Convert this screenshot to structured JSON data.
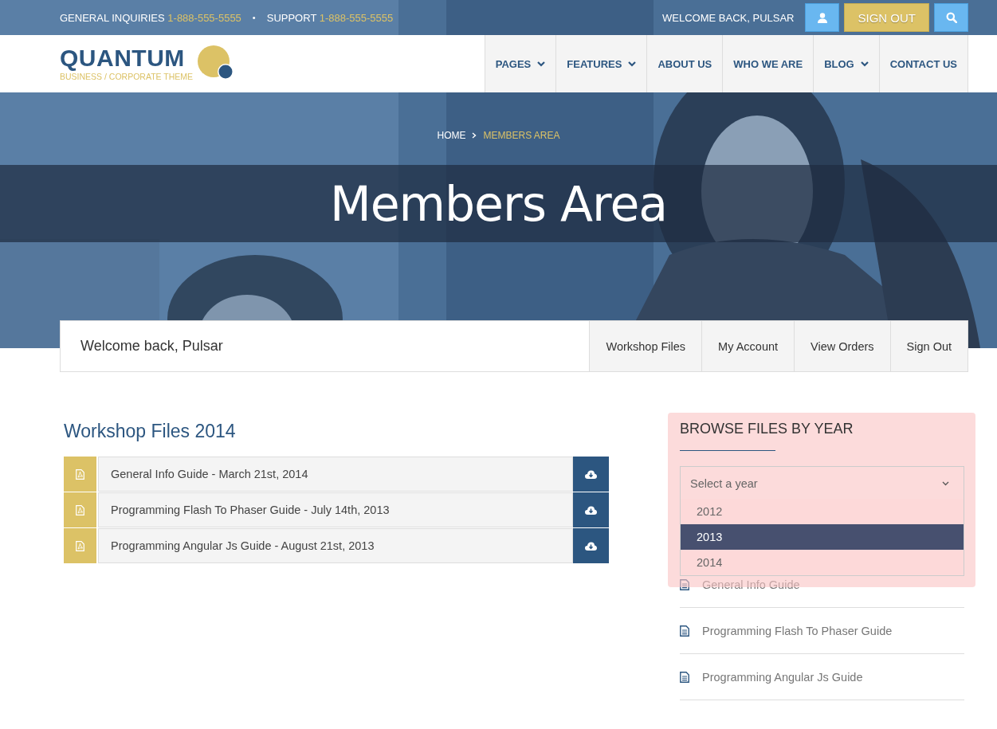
{
  "top_bar": {
    "inquiries_label": "GENERAL INQUIRIES",
    "inquiries_phone": "1-888-555-5555",
    "separator": "•",
    "support_label": "SUPPORT",
    "support_phone": "1-888-555-5555",
    "welcome": "WELCOME BACK, PULSAR",
    "sign_out": "SIGN OUT"
  },
  "logo": {
    "name": "QUANTUM",
    "tagline": "BUSINESS / CORPORATE THEME"
  },
  "nav": [
    {
      "label": "PAGES",
      "has_menu": true
    },
    {
      "label": "FEATURES",
      "has_menu": true
    },
    {
      "label": "ABOUT US",
      "has_menu": false
    },
    {
      "label": "WHO WE ARE",
      "has_menu": false
    },
    {
      "label": "BLOG",
      "has_menu": true
    },
    {
      "label": "CONTACT US",
      "has_menu": false
    }
  ],
  "hero": {
    "breadcrumb": [
      {
        "label": "HOME",
        "current": false
      },
      {
        "label": "MEMBERS AREA",
        "current": true
      }
    ],
    "title": "Members Area"
  },
  "member_bar": {
    "welcome": "Welcome back, Pulsar",
    "links": [
      "Workshop Files",
      "My Account",
      "View Orders",
      "Sign Out"
    ]
  },
  "files": {
    "title": "Workshop Files 2014",
    "items": [
      "General Info Guide - March 21st, 2014",
      "Programming Flash To Phaser Guide - July 14th, 2013",
      "Programming Angular Js Guide - August 21st, 2013"
    ]
  },
  "sidebar": {
    "title": "BROWSE FILES BY YEAR",
    "select": {
      "placeholder": "Select a year",
      "options": [
        {
          "label": "2012",
          "selected": false
        },
        {
          "label": "2013",
          "selected": true
        },
        {
          "label": "2014",
          "selected": false
        }
      ]
    },
    "files": [
      "General Info Guide",
      "Programming Flash To Phaser Guide",
      "Programming Angular Js Guide"
    ]
  }
}
